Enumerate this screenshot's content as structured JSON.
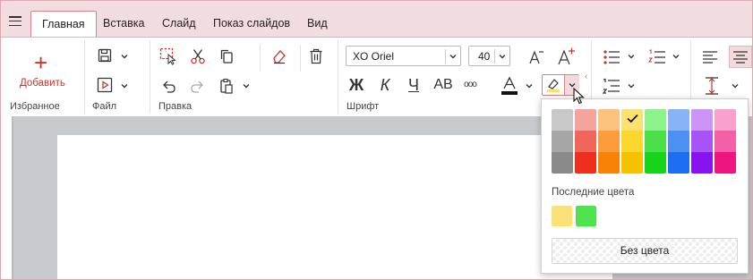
{
  "tabs": [
    {
      "label": "Главная",
      "active": true
    },
    {
      "label": "Вставка"
    },
    {
      "label": "Слайд"
    },
    {
      "label": "Показ слайдов"
    },
    {
      "label": "Вид"
    }
  ],
  "ribbon": {
    "favorites": {
      "add_label": "Добавить",
      "group_label": "Избранное"
    },
    "file": {
      "group_label": "Файл"
    },
    "edit": {
      "group_label": "Правка"
    },
    "font": {
      "group_label": "Шрифт",
      "font_name": "XO Oriel",
      "font_size": "40",
      "format_buttons": {
        "bold": "Ж",
        "italic": "К",
        "underline": "Ч",
        "caps": "АВ",
        "more": "ooo"
      }
    }
  },
  "highlight_popup": {
    "palette_columns": [
      [
        "#c8c8c8",
        "#a6a6a6",
        "#8a8a8a"
      ],
      [
        "#f4a49c",
        "#f1665a",
        "#ee2f1e"
      ],
      [
        "#fcc27e",
        "#fb9d3c",
        "#f78207"
      ],
      [
        "#fbe16f",
        "#fbd730",
        "#f6c200"
      ],
      [
        "#8df28c",
        "#4be04a",
        "#18d418"
      ],
      [
        "#87b4f4",
        "#4d90f1",
        "#1c6df0"
      ],
      [
        "#cc94f7",
        "#a654f5",
        "#8714ef"
      ],
      [
        "#f9a1cc",
        "#f55fa8",
        "#ef1580"
      ]
    ],
    "selected": "#fbe16f",
    "recent_label": "Последние цвета",
    "recent_colors": [
      "#fbe178",
      "#4ee24d"
    ],
    "no_color_label": "Без цвета"
  }
}
